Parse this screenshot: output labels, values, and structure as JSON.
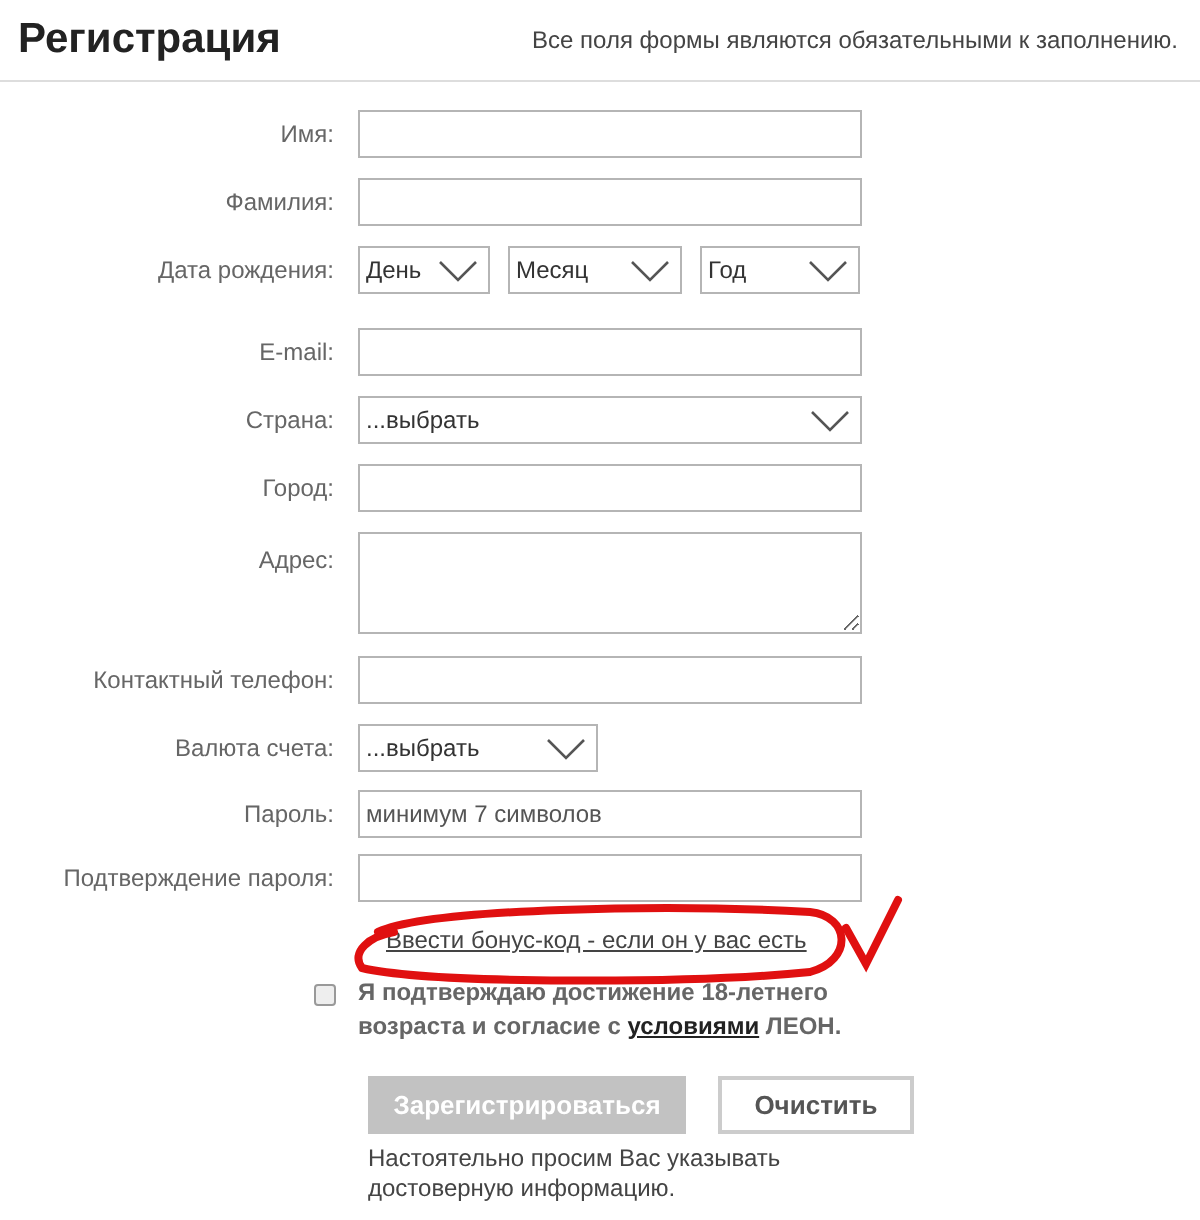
{
  "header": {
    "title": "Регистрация",
    "note": "Все поля формы являются обязательными к заполнению."
  },
  "fields": [
    {
      "kind": "text",
      "label": "Имя:"
    },
    {
      "kind": "text",
      "label": "Фамилия:"
    },
    {
      "kind": "date",
      "label": "Дата рождения:",
      "parts": [
        "День",
        "Месяц",
        "Год"
      ]
    },
    {
      "kind": "text",
      "label": "E-mail:"
    },
    {
      "kind": "select",
      "label": "Страна:",
      "value": "...выбрать"
    },
    {
      "kind": "text",
      "label": "Город:"
    },
    {
      "kind": "textarea",
      "label": "Адрес:"
    },
    {
      "kind": "text",
      "label": "Контактный телефон:"
    },
    {
      "kind": "short-select",
      "label": "Валюта счета:",
      "value": "...выбрать"
    },
    {
      "kind": "text",
      "label": "Пароль:",
      "placeholder": "минимум 7 символов"
    },
    {
      "kind": "text",
      "label": "Подтверждение пароля:"
    }
  ],
  "bonus_link": "Ввести бонус-код - если он у вас есть",
  "agreement": {
    "checked": false,
    "text": "Я подтверждаю достижение 18-летнего возраста и согласие с",
    "link": "условиями",
    "suffix": "ЛЕОН."
  },
  "buttons": [
    {
      "label": "Зарегистрироваться",
      "disabled": true
    },
    {
      "label": "Очистить",
      "disabled": false
    }
  ],
  "footer_note": "Настоятельно просим Вас указывать достоверную информацию."
}
